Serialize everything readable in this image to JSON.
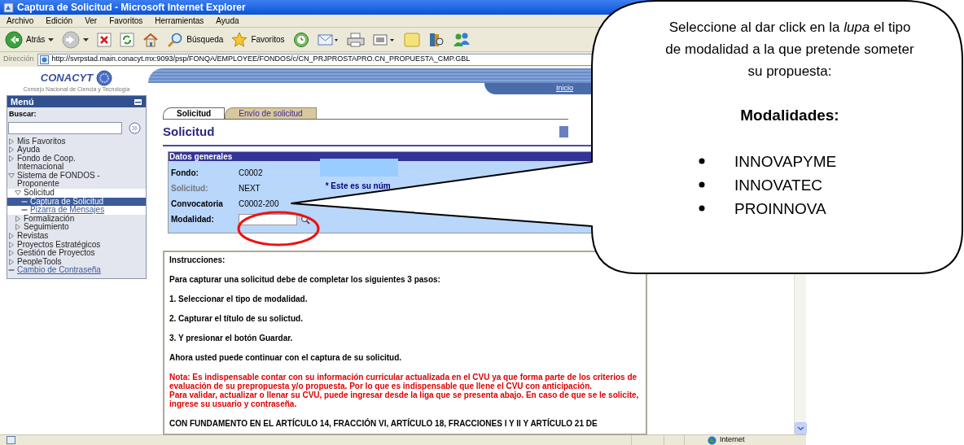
{
  "window": {
    "title": "Captura de Solicitud - Microsoft Internet Explorer"
  },
  "menu_bar": [
    "Archivo",
    "Edición",
    "Ver",
    "Favoritos",
    "Herramientas",
    "Ayuda"
  ],
  "toolbar": [
    {
      "kind": "back",
      "label": "Atrás"
    },
    {
      "kind": "forward"
    },
    {
      "kind": "stop"
    },
    {
      "kind": "refresh"
    },
    {
      "kind": "home"
    },
    {
      "kind": "search",
      "label": "Búsqueda"
    },
    {
      "kind": "favorites",
      "label": "Favoritos"
    },
    {
      "kind": "history"
    },
    {
      "kind": "mail"
    },
    {
      "kind": "print"
    },
    {
      "kind": "edit"
    },
    {
      "kind": "notes"
    },
    {
      "kind": "research"
    },
    {
      "kind": "messenger"
    }
  ],
  "address_bar": {
    "label": "Dirección",
    "url": "http://svrpstad.main.conacyt.mx:9093/psp/FONQA/EMPLOYEE/FONDOS/c/CN_PRJPROSTAPRO.CN_PROPUESTA_CMP.GBL"
  },
  "logo": {
    "name": "CONACYT",
    "subtitle": "Consejo Nacional de Ciencia y Tecnología"
  },
  "sidebar": {
    "title": "Menú",
    "search_label": "Buscar:",
    "items": [
      {
        "label": "Mis Favoritos",
        "kind": "folder",
        "expanded": false
      },
      {
        "label": "Ayuda",
        "kind": "folder",
        "expanded": false
      },
      {
        "label": "Fondo de Coop. Internacional",
        "kind": "folder",
        "expanded": false
      },
      {
        "label": "Sistema de FONDOS - Proponente",
        "kind": "folder",
        "expanded": true,
        "children": [
          {
            "label": "Solicitud",
            "kind": "folder",
            "expanded": true,
            "children": [
              {
                "label": "Captura de Solicitud",
                "kind": "page",
                "selected": true
              },
              {
                "label": "Pizarra de Mensajes",
                "kind": "page",
                "selected": false
              }
            ]
          },
          {
            "label": "Formalización",
            "kind": "folder",
            "expanded": false
          },
          {
            "label": "Seguimiento",
            "kind": "folder",
            "expanded": false
          }
        ]
      },
      {
        "label": "Revistas",
        "kind": "folder",
        "expanded": false
      },
      {
        "label": "Proyectos Estratégicos",
        "kind": "folder",
        "expanded": false
      },
      {
        "label": "Gestión de Proyectos",
        "kind": "folder",
        "expanded": false
      },
      {
        "label": "PeopleTools",
        "kind": "folder",
        "expanded": false
      },
      {
        "label": "Cambio de Contraseña",
        "kind": "page",
        "selected": false
      }
    ]
  },
  "header": {
    "home_link": "Inicio"
  },
  "tabs": [
    {
      "label": "Solicitud",
      "selected": true
    },
    {
      "label": "Envío de solicitud",
      "selected": false
    }
  ],
  "page_title": "Solicitud",
  "general_data": {
    "title": "Datos generales",
    "fields": [
      {
        "label": "Fondo:",
        "kind": "text",
        "value": "C0002",
        "disabled": false
      },
      {
        "label": "Solicitud:",
        "kind": "text",
        "value": "NEXT",
        "disabled": true,
        "note": "* Este es su núm"
      },
      {
        "label": "Convocatoria",
        "kind": "text",
        "value": "C0002-200",
        "disabled": false
      },
      {
        "label": "Modalidad:",
        "kind": "lookup",
        "disabled": false
      }
    ]
  },
  "instructions": [
    {
      "kind": "normal",
      "text": "Instrucciones:"
    },
    {
      "kind": "normal",
      "text": "Para capturar una solicitud debe de completar los siguientes 3 pasos:"
    },
    {
      "kind": "normal",
      "text": "1. Seleccionar el tipo de modalidad."
    },
    {
      "kind": "normal",
      "text": "2. Capturar el título de su solictud."
    },
    {
      "kind": "normal",
      "text": "3. Y presionar el botón Guardar."
    },
    {
      "kind": "normal",
      "text": "Ahora usted puede continuar con el captura de su solicitud."
    },
    {
      "kind": "note",
      "text": "Nota: Es indispensable contar con su información curricular actualizada en el CVU ya que forma parte de los criterios de evaluación de su prepropuesta y/o propuesta. Por lo que es indispensable que llene el CVU con anticipación."
    },
    {
      "kind": "note",
      "text": "Para validar, actualizar o llenar su CVU, puede ingresar desde la liga que se presenta abajo. En caso de que se le solicite, ingrese su usuario y contraseña."
    },
    {
      "kind": "normal",
      "text": "CON FUNDAMENTO EN EL ARTÍCULO 14, FRACCIÓN VI, ARTÍCULO 18, FRACCIONES I Y II Y ARTÍCULO 21 DE"
    }
  ],
  "status_bar": {
    "zone": "Internet"
  },
  "callout": {
    "text": "Seleccione al dar click en la *lupa* el tipo de modalidad a la que pretende someter su propuesta:",
    "heading": "Modalidades:",
    "items": [
      "INNOVAPYME",
      "INNOVATEC",
      "PROINNOVA"
    ]
  }
}
